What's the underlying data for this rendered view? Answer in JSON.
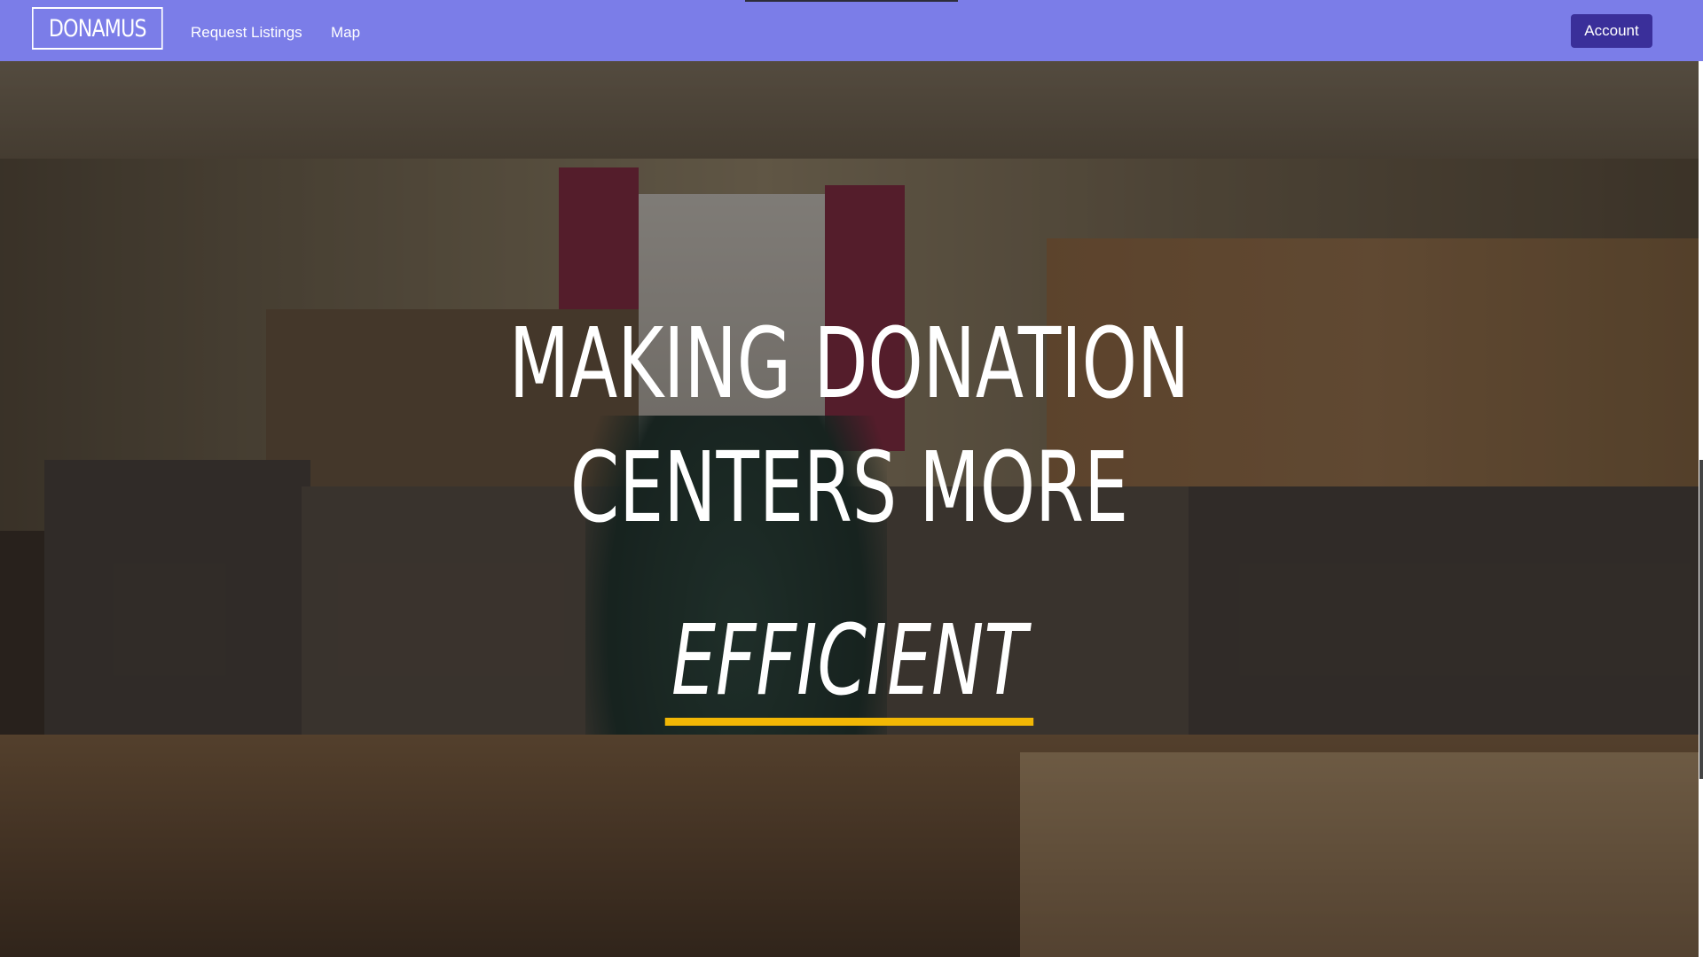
{
  "nav": {
    "brand": "DONAMUS",
    "links": [
      "Request Listings",
      "Map"
    ],
    "account_label": "Account"
  },
  "hero": {
    "headline_lines": [
      "MAKING DONATION",
      "CENTERS MORE"
    ],
    "emphasis": "EFFICIENT"
  },
  "colors": {
    "navbar": "#7b7de8",
    "account_button": "#3a2f9a",
    "underline": "#f2b705"
  }
}
